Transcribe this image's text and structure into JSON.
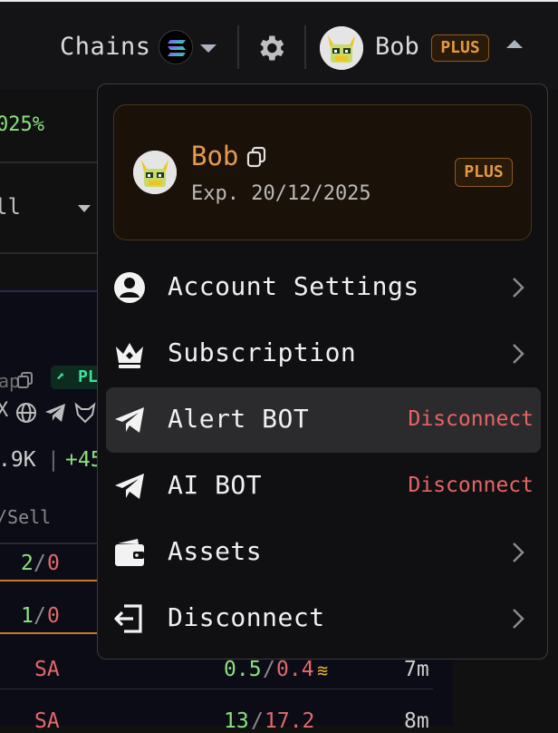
{
  "header": {
    "chains_label": "Chains",
    "user_name": "Bob",
    "plan_badge": "PLUS"
  },
  "background": {
    "percent": "025%",
    "select_fragment": "ll",
    "tag_fragment": "ap",
    "pl_tag": "PL",
    "stat_fragment": ".9K",
    "stat_sep": "|",
    "stat_change": "+45",
    "col_fragment": "/Sell",
    "rows": [
      {
        "a": "2",
        "b": "0"
      },
      {
        "a": "1",
        "b": "0"
      }
    ],
    "trades": [
      {
        "sym": "SA",
        "buy": "0.5",
        "sell": "0.4",
        "age": "7m"
      },
      {
        "sym": "SA",
        "buy": "13",
        "sell": "17.2",
        "age": "8m"
      }
    ]
  },
  "profile_card": {
    "name": "Bob",
    "expiry": "Exp. 20/12/2025",
    "plan_badge": "PLUS"
  },
  "menu": {
    "items": [
      {
        "label": "Account Settings",
        "icon": "user-circle-icon"
      },
      {
        "label": "Subscription",
        "icon": "crown-icon"
      },
      {
        "label": "Alert BOT",
        "icon": "telegram-icon",
        "status": "Disconnect"
      },
      {
        "label": "AI BOT",
        "icon": "telegram-icon",
        "status": "Disconnect"
      },
      {
        "label": "Assets",
        "icon": "wallet-icon"
      },
      {
        "label": "Disconnect",
        "icon": "logout-icon"
      }
    ]
  },
  "colors": {
    "accent_orange": "#e69a52",
    "status_red": "#e86464",
    "positive_green": "#8be27d"
  }
}
